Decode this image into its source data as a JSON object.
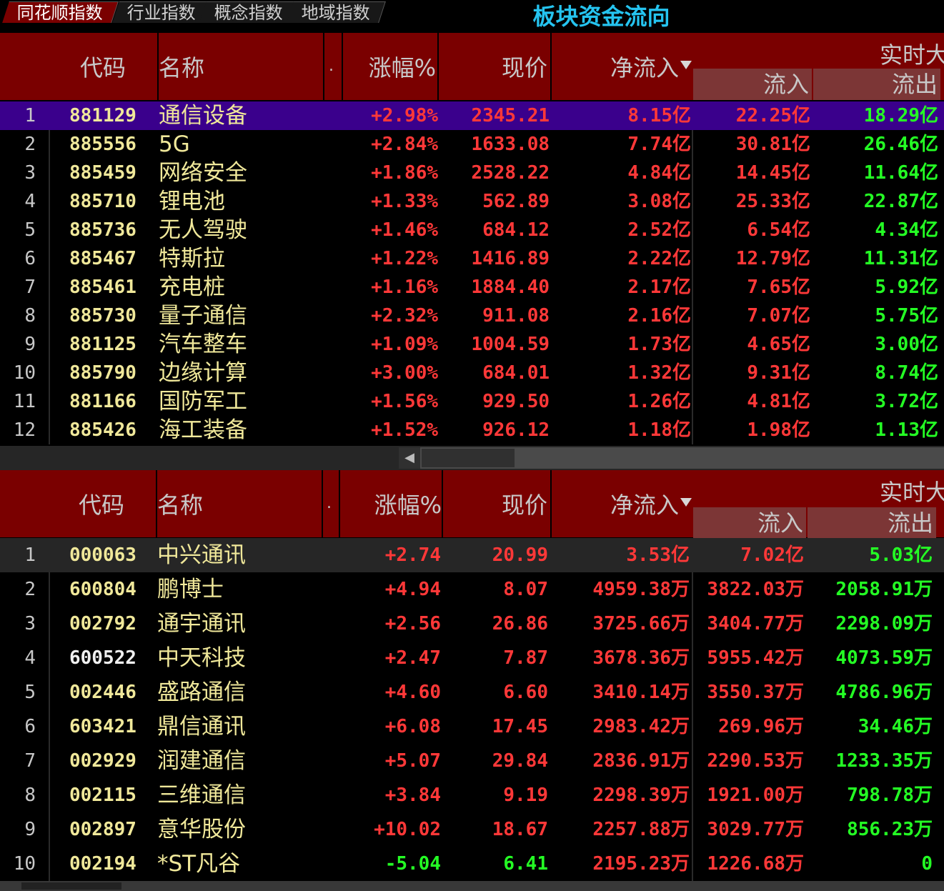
{
  "title": "板块资金流向",
  "top_table": {
    "headers": {
      "code": "代码",
      "name": "名称",
      "dot": ".",
      "change": "涨幅%",
      "price": "现价",
      "net_inflow": "净流入",
      "realtime": "实时大",
      "inflow": "流入",
      "outflow": "流出"
    },
    "rows": [
      {
        "idx": "1",
        "code": "881129",
        "name": "通信设备",
        "change": "+2.98%",
        "price": "2345.21",
        "net": "8.15亿",
        "in": "22.25亿",
        "out": "18.29亿"
      },
      {
        "idx": "2",
        "code": "885556",
        "name": "5G",
        "change": "+2.84%",
        "price": "1633.08",
        "net": "7.74亿",
        "in": "30.81亿",
        "out": "26.46亿"
      },
      {
        "idx": "3",
        "code": "885459",
        "name": "网络安全",
        "change": "+1.86%",
        "price": "2528.22",
        "net": "4.84亿",
        "in": "14.45亿",
        "out": "11.64亿"
      },
      {
        "idx": "4",
        "code": "885710",
        "name": "锂电池",
        "change": "+1.33%",
        "price": "562.89",
        "net": "3.08亿",
        "in": "25.33亿",
        "out": "22.87亿"
      },
      {
        "idx": "5",
        "code": "885736",
        "name": "无人驾驶",
        "change": "+1.46%",
        "price": "684.12",
        "net": "2.52亿",
        "in": "6.54亿",
        "out": "4.34亿"
      },
      {
        "idx": "6",
        "code": "885467",
        "name": "特斯拉",
        "change": "+1.22%",
        "price": "1416.89",
        "net": "2.22亿",
        "in": "12.79亿",
        "out": "11.31亿"
      },
      {
        "idx": "7",
        "code": "885461",
        "name": "充电桩",
        "change": "+1.16%",
        "price": "1884.40",
        "net": "2.17亿",
        "in": "7.65亿",
        "out": "5.92亿"
      },
      {
        "idx": "8",
        "code": "885730",
        "name": "量子通信",
        "change": "+2.32%",
        "price": "911.08",
        "net": "2.16亿",
        "in": "7.07亿",
        "out": "5.75亿"
      },
      {
        "idx": "9",
        "code": "881125",
        "name": "汽车整车",
        "change": "+1.09%",
        "price": "1004.59",
        "net": "1.73亿",
        "in": "4.65亿",
        "out": "3.00亿"
      },
      {
        "idx": "10",
        "code": "885790",
        "name": "边缘计算",
        "change": "+3.00%",
        "price": "684.01",
        "net": "1.32亿",
        "in": "9.31亿",
        "out": "8.74亿"
      },
      {
        "idx": "11",
        "code": "881166",
        "name": "国防军工",
        "change": "+1.56%",
        "price": "929.50",
        "net": "1.26亿",
        "in": "4.81亿",
        "out": "3.72亿"
      },
      {
        "idx": "12",
        "code": "885426",
        "name": "海工装备",
        "change": "+1.52%",
        "price": "926.12",
        "net": "1.18亿",
        "in": "1.98亿",
        "out": "1.13亿"
      }
    ]
  },
  "tabs": [
    "同花顺指数",
    "行业指数",
    "概念指数",
    "地域指数"
  ],
  "bottom_table": {
    "headers": {
      "code": "代码",
      "name": "名称",
      "dot": ".",
      "change": "涨幅%",
      "price": "现价",
      "net_inflow": "净流入",
      "realtime": "实时大",
      "inflow": "流入",
      "outflow": "流出"
    },
    "rows": [
      {
        "idx": "1",
        "code": "000063",
        "name": "中兴通讯",
        "change": "+2.74",
        "price": "20.99",
        "net": "3.53亿",
        "in": "7.02亿",
        "out": "5.03亿",
        "neg": false,
        "code_white": false
      },
      {
        "idx": "2",
        "code": "600804",
        "name": "鹏博士",
        "change": "+4.94",
        "price": "8.07",
        "net": "4959.38万",
        "in": "3822.03万",
        "out": "2058.91万",
        "neg": false,
        "code_white": false
      },
      {
        "idx": "3",
        "code": "002792",
        "name": "通宇通讯",
        "change": "+2.56",
        "price": "26.86",
        "net": "3725.66万",
        "in": "3404.77万",
        "out": "2298.09万",
        "neg": false,
        "code_white": false
      },
      {
        "idx": "4",
        "code": "600522",
        "name": "中天科技",
        "change": "+2.47",
        "price": "7.87",
        "net": "3678.36万",
        "in": "5955.42万",
        "out": "4073.59万",
        "neg": false,
        "code_white": true
      },
      {
        "idx": "5",
        "code": "002446",
        "name": "盛路通信",
        "change": "+4.60",
        "price": "6.60",
        "net": "3410.14万",
        "in": "3550.37万",
        "out": "4786.96万",
        "neg": false,
        "code_white": false
      },
      {
        "idx": "6",
        "code": "603421",
        "name": "鼎信通讯",
        "change": "+6.08",
        "price": "17.45",
        "net": "2983.42万",
        "in": "269.96万",
        "out": "34.46万",
        "neg": false,
        "code_white": false
      },
      {
        "idx": "7",
        "code": "002929",
        "name": "润建通信",
        "change": "+5.07",
        "price": "29.84",
        "net": "2836.91万",
        "in": "2290.53万",
        "out": "1233.35万",
        "neg": false,
        "code_white": false
      },
      {
        "idx": "8",
        "code": "002115",
        "name": "三维通信",
        "change": "+3.84",
        "price": "9.19",
        "net": "2298.39万",
        "in": "1921.00万",
        "out": "798.78万",
        "neg": false,
        "code_white": false
      },
      {
        "idx": "9",
        "code": "002897",
        "name": "意华股份",
        "change": "+10.02",
        "price": "18.67",
        "net": "2257.88万",
        "in": "3029.77万",
        "out": "856.23万",
        "neg": false,
        "code_white": false
      },
      {
        "idx": "10",
        "code": "002194",
        "name": "*ST凡谷",
        "change": "-5.04",
        "price": "6.41",
        "net": "2195.23万",
        "in": "1226.68万",
        "out": "0",
        "neg": true,
        "code_white": false
      }
    ]
  },
  "colors": {
    "header_bg": "#7a0000",
    "sub_header_bg": "#7c3636",
    "selected_row": "#3a008c",
    "up": "#ff3838",
    "down": "#24ff24",
    "code": "#f0e89a",
    "title": "#25c4f0"
  }
}
